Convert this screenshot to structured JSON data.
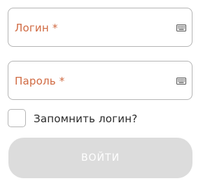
{
  "form": {
    "login": {
      "label": "Логин *",
      "icon": "keyboard-icon"
    },
    "password": {
      "label": "Пароль *",
      "icon": "keyboard-icon"
    },
    "remember": {
      "label": "Запомнить логин?",
      "checked": false
    },
    "submit": {
      "label": "ВОЙТИ",
      "enabled": false
    }
  },
  "colors": {
    "label_accent": "#d06a42",
    "border": "#b5b5b5",
    "button_disabled_bg": "#dcdcdc",
    "button_disabled_text": "#ffffff",
    "text": "#2a2a2a"
  }
}
